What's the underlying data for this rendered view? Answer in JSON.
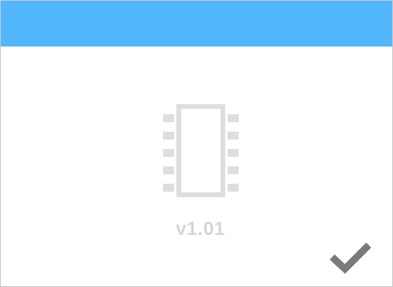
{
  "colors": {
    "header": "#52b6fb",
    "icon": "#dedede",
    "version_text": "#d6d6d6",
    "check": "#7a7a7a"
  },
  "header": {
    "title": ""
  },
  "main": {
    "icon": "microchip-icon",
    "version": "v1.01"
  },
  "actions": {
    "confirm_icon": "checkmark-icon"
  }
}
